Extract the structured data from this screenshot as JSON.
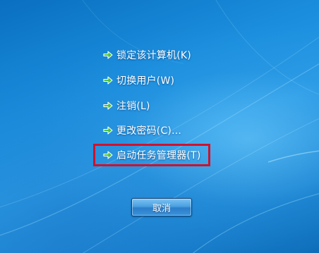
{
  "colors": {
    "background": "#1b8fde",
    "arrow": "#4cc13b",
    "highlight_border": "#d0112b",
    "text": "#ffffff"
  },
  "menu": {
    "items": [
      {
        "label": "锁定该计算机(K)",
        "icon": "green-arrow-icon"
      },
      {
        "label": "切换用户(W)",
        "icon": "green-arrow-icon"
      },
      {
        "label": "注销(L)",
        "icon": "green-arrow-icon"
      },
      {
        "label": "更改密码(C)...",
        "icon": "green-arrow-icon"
      },
      {
        "label": "启动任务管理器(T)",
        "icon": "green-arrow-icon"
      }
    ]
  },
  "cancel_button": {
    "label": "取消"
  }
}
